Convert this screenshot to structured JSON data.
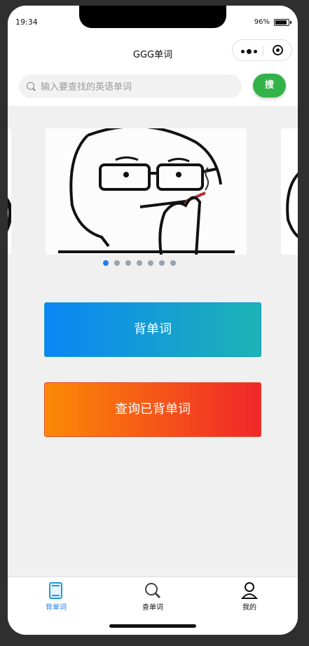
{
  "status": {
    "time": "19:34",
    "battery": "96%"
  },
  "nav": {
    "title": "GGG单词"
  },
  "search": {
    "placeholder": "输入要查找的英语单词",
    "button": "搜"
  },
  "carousel": {
    "slides": 7,
    "active_index": 0
  },
  "actions": {
    "memorize": "背单词",
    "review": "查询已背单词"
  },
  "tabs": [
    {
      "label": "背单词",
      "icon": "book-icon",
      "active": true
    },
    {
      "label": "查单词",
      "icon": "search-icon",
      "active": false
    },
    {
      "label": "我的",
      "icon": "person-icon",
      "active": false
    }
  ],
  "colors": {
    "search_button": "#34b24a",
    "memorize_gradient": [
      "#0a86f5",
      "#1db3b5"
    ],
    "review_gradient": [
      "#fb8a05",
      "#f0262a"
    ],
    "active_tab": "#1f7ef0"
  }
}
